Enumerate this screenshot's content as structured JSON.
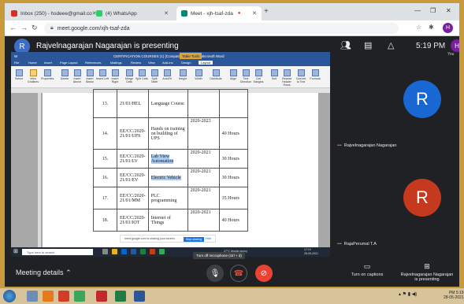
{
  "browser": {
    "tabs": [
      {
        "title": "Inbox (250) - hsdeee@gmail.co",
        "favicon_color": "#d93025",
        "active": false
      },
      {
        "title": "(4) WhatsApp",
        "favicon_color": "#25d366",
        "active": false
      },
      {
        "title": "Meet - xjh-tsaf-zda",
        "favicon_color": "#00897b",
        "active": true
      }
    ],
    "url": "meet.google.com/xjh-tsaf-zda",
    "profile_initial": "H"
  },
  "meet": {
    "presenter_initial": "R",
    "presenting_title": "Rajvelnagarajan Nagarajan is presenting",
    "time": "5:19 PM",
    "you_label": "You",
    "you_initial": "H",
    "participants": [
      {
        "initial": "R",
        "name": "Rajvelnagarajan Nagarajan",
        "color": "#1967d2"
      },
      {
        "initial": "R",
        "name": "RajaPerumal T.A",
        "color": "#c5391f"
      }
    ],
    "meeting_details": "Meeting details",
    "mic_tooltip": "Turn off microphone (ctrl + d)",
    "captions_label": "Turn on captions",
    "present_label": "Rajvelnagarajan Nagarajan is presenting"
  },
  "word": {
    "doc_title": "CERTIFICATION COURSES (1) [Compatibility Mode] - Microsoft Word",
    "context_tab": "Table Tools",
    "tabs": [
      "File",
      "Home",
      "Insert",
      "Page Layout",
      "References",
      "Mailings",
      "Review",
      "View",
      "Add-ins",
      "Design",
      "Layout"
    ],
    "ribbon_buttons": [
      "Select",
      "View Gridlines",
      "Properties",
      "Delete",
      "Insert Above",
      "Insert Below",
      "Insert Left",
      "Insert Right",
      "Merge Cells",
      "Split Cells",
      "Split Table",
      "AutoFit",
      "Height",
      "Width",
      "Distribute",
      "Align",
      "Text Direction",
      "Cell Margins",
      "Sort",
      "Repeat Header Rows",
      "Convert to Text",
      "Formula"
    ],
    "rows": [
      {
        "no": "13.",
        "code": "21/01/HEL",
        "course": "Language Course",
        "year": "",
        "hours": "",
        "hl": false
      },
      {
        "no": "14.",
        "code": "EE/CC/2020-21/01/UPS",
        "course": "Hands on training on building of UPS",
        "year": "2020-2023",
        "hours": "40 Hours",
        "hl": false
      },
      {
        "no": "15.",
        "code": "EE/CC/2020-21/01/LV",
        "course": "Lab View Automation",
        "year": "2020-2021",
        "hours": "30 Hours",
        "hl": true
      },
      {
        "no": "16.",
        "code": "EE/CC/2020-21/01/EV",
        "course": "Electric Vehicle",
        "year": "2020-2021",
        "hours": "30 Hours",
        "hl": true
      },
      {
        "no": "17.",
        "code": "EE/CC/2020-21/01/MM",
        "course": "PLC programming",
        "year": "2020-2021",
        "hours": "35 Hours",
        "hl": false
      },
      {
        "no": "18.",
        "code": "EE/CC/2020-21/01/IOT",
        "course": "Internet of Things",
        "year": "2020-2021",
        "hours": "40 Hours",
        "hl": false
      }
    ],
    "share_text": "meet.google.com is sharing your screen.",
    "stop_sharing": "Stop sharing",
    "hide": "Hide"
  },
  "captured_taskbar": {
    "search_placeholder": "Type here to search",
    "weather": "27°C Mostly sunny",
    "time": "17:19",
    "date": "28-05-2021"
  },
  "host_taskbar": {
    "time": "PM 5:19",
    "date": "28-05-2021"
  }
}
